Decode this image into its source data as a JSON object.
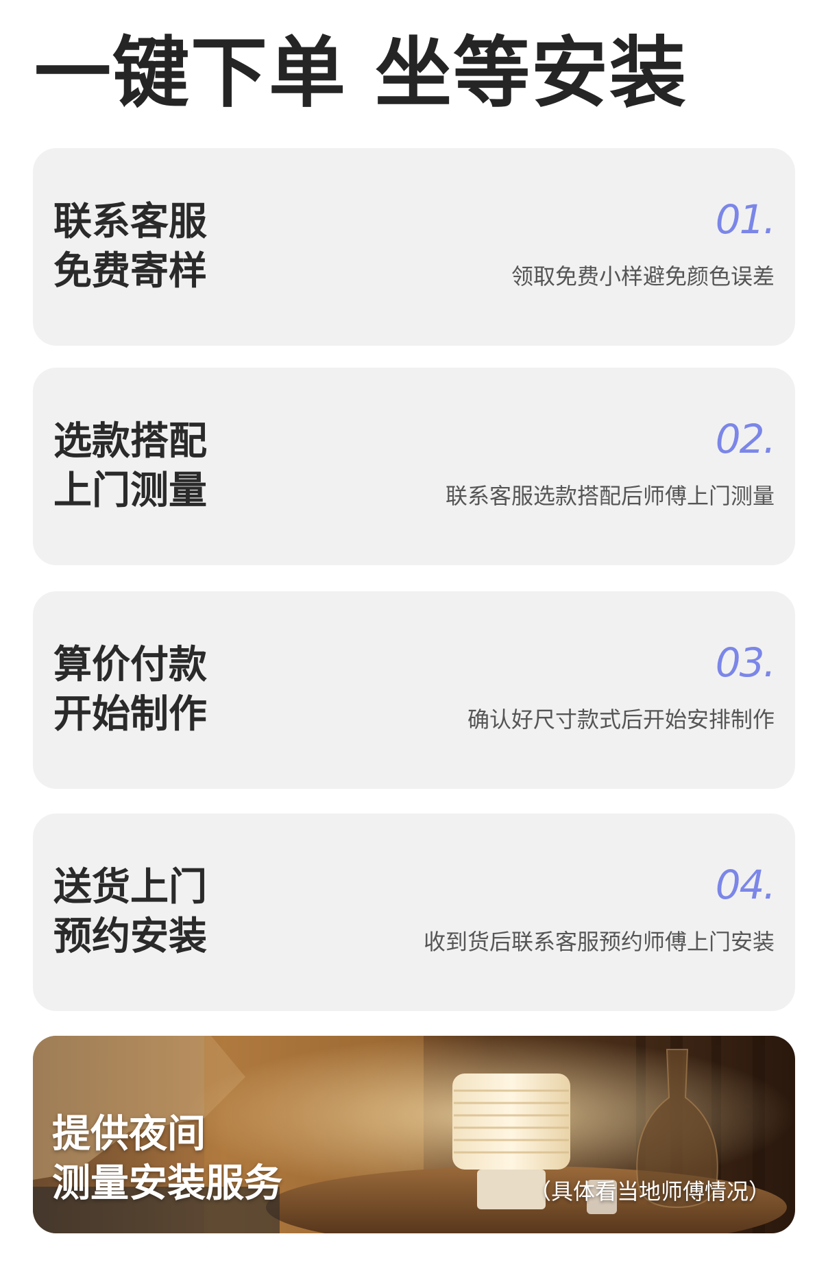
{
  "title": "一键下单 坐等安装",
  "steps": [
    {
      "title_line1": "联系客服",
      "title_line2": "免费寄样",
      "number": "01.",
      "desc": "领取免费小样避免颜色误差"
    },
    {
      "title_line1": "选款搭配",
      "title_line2": "上门测量",
      "number": "02.",
      "desc": "联系客服选款搭配后师傅上门测量"
    },
    {
      "title_line1": "算价付款",
      "title_line2": "开始制作",
      "number": "03.",
      "desc": "确认好尺寸款式后开始安排制作"
    },
    {
      "title_line1": "送货上门",
      "title_line2": "预约安装",
      "number": "04.",
      "desc": "收到货后联系客服预约师傅上门安装"
    }
  ],
  "banner": {
    "title_line1": "提供夜间",
    "title_line2": "测量安装服务",
    "note": "（具体看当地师傅情况）"
  },
  "colors": {
    "accent_number": "#7b86e8",
    "card_bg": "#f1f1f1",
    "title_text": "#252525"
  }
}
